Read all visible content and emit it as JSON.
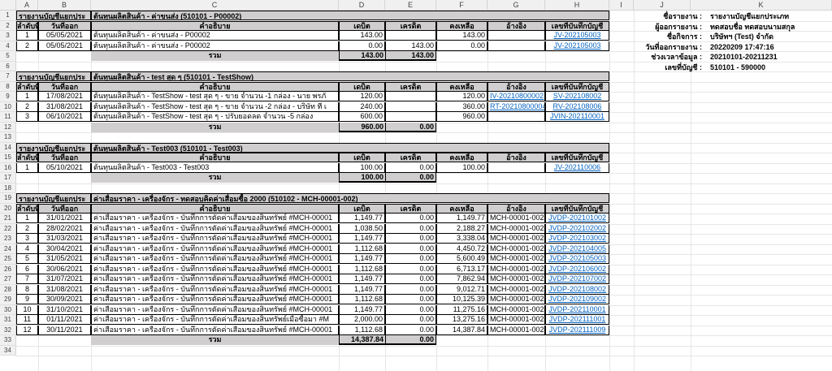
{
  "column_headers": [
    "A",
    "B",
    "C",
    "D",
    "E",
    "F",
    "G",
    "H",
    "I",
    "J",
    "K"
  ],
  "row_numbers": [
    "1",
    "2",
    "3",
    "4",
    "5",
    "6",
    "7",
    "8",
    "9",
    "10",
    "11",
    "12",
    "13",
    "14",
    "15",
    "16",
    "17",
    "18",
    "19",
    "20",
    "21",
    "22",
    "23",
    "24",
    "25",
    "26",
    "27",
    "28",
    "29",
    "30",
    "31",
    "32",
    "33",
    "34"
  ],
  "table_headers": {
    "seq": "ลำดับที่",
    "date": "วันที่ออก",
    "desc": "คำอธิบาย",
    "debit": "เดบิต",
    "credit": "เครดิต",
    "balance": "คงเหลือ",
    "ref": "อ้างอิง",
    "doc": "เลขที่บันทึกบัญชี"
  },
  "total_label": "รวม",
  "info": {
    "labels": [
      "ชื่อรายงาน :",
      "ผู้ออกรายงาน :",
      "ชื่อกิจการ :",
      "วันที่ออกรายงาน :",
      "ช่วงเวลาข้อมูล :",
      "เลขที่บัญชี :"
    ],
    "values": [
      "รายงานบัญชีแยกประเภท",
      "ทดสอบชื่อ ทดสอบนามสกุล",
      "บริษัทฯ (Test) จำกัด",
      "20220209 17:47:16",
      "20210101-20211231",
      "510101 - 590000"
    ]
  },
  "sections": [
    {
      "prefix": "รายงานบัญชีแยกประ",
      "title": "ต้นทุนผลิตสินค้า - ค่าขนส่ง (510101 - P00002)",
      "rows": [
        {
          "seq": "1",
          "date": "05/05/2021",
          "desc": "ต้นทุนผลิตสินค้า - ค่าขนส่ง - P00002",
          "debit": "143.00",
          "credit": "",
          "balance": "143.00",
          "ref": "",
          "doc": "JV-202105003"
        },
        {
          "seq": "2",
          "date": "05/05/2021",
          "desc": "ต้นทุนผลิตสินค้า - ค่าขนส่ง - P00002",
          "debit": "0.00",
          "credit": "143.00",
          "balance": "0.00",
          "ref": "",
          "doc": "JV-202105003"
        }
      ],
      "total_debit": "143.00",
      "total_credit": "143.00"
    },
    {
      "prefix": "รายงานบัญชีแยกประ",
      "title": "ต้นทุนผลิตสินค้า - test สุด ๆ (510101 - TestShow)",
      "rows": [
        {
          "seq": "1",
          "date": "17/08/2021",
          "desc": "ต้นทุนผลิตสินค้า - TestShow - test สุด ๆ - ขาย จำนวน -1 กล่อง - นาย พรภั",
          "debit": "120.00",
          "credit": "",
          "balance": "120.00",
          "ref": "IV-20210800002",
          "doc": "SV-202108002"
        },
        {
          "seq": "2",
          "date": "31/08/2021",
          "desc": "ต้นทุนผลิตสินค้า - TestShow - test สุด ๆ - ขาย จำนวน -2 กล่อง - บริษัท ที่ เ",
          "debit": "240.00",
          "credit": "",
          "balance": "360.00",
          "ref": "RT-20210800004",
          "doc": "RV-202108006"
        },
        {
          "seq": "3",
          "date": "06/10/2021",
          "desc": "ต้นทุนผลิตสินค้า - TestShow - test สุด ๆ - ปรับยอดลด จำนวน -5 กล่อง",
          "debit": "600.00",
          "credit": "",
          "balance": "960.00",
          "ref": "",
          "doc": "JVIN-202110001"
        }
      ],
      "total_debit": "960.00",
      "total_credit": "0.00"
    },
    {
      "prefix": "รายงานบัญชีแยกประ",
      "title": "ต้นทุนผลิตสินค้า - Test003 (510101 - Test003)",
      "rows": [
        {
          "seq": "1",
          "date": "05/10/2021",
          "desc": "ต้นทุนผลิตสินค้า - Test003 - Test003",
          "debit": "100.00",
          "credit": "0.00",
          "balance": "100.00",
          "ref": "",
          "doc": "JV-202110006"
        }
      ],
      "total_debit": "100.00",
      "total_credit": "0.00"
    },
    {
      "prefix": "รายงานบัญชีแยกประ",
      "title": "ค่าเสื่อมราคา - เครื่องจักร - ทดสอบคิดค่าเสื่อมซื้อ 2000 (510102 - MCH-00001-002)",
      "rows": [
        {
          "seq": "1",
          "date": "31/01/2021",
          "desc": "ค่าเสื่อมราคา - เครื่องจักร - บันทึกการตัดค่าเสื่อมของสินทรัพย์ #MCH-00001",
          "debit": "1,149.77",
          "credit": "0.00",
          "balance": "1,149.77",
          "ref": "MCH-00001-002",
          "doc": "JVDP-202101002"
        },
        {
          "seq": "2",
          "date": "28/02/2021",
          "desc": "ค่าเสื่อมราคา - เครื่องจักร - บันทึกการตัดค่าเสื่อมของสินทรัพย์ #MCH-00001",
          "debit": "1,038.50",
          "credit": "0.00",
          "balance": "2,188.27",
          "ref": "MCH-00001-002",
          "doc": "JVDP-202102002"
        },
        {
          "seq": "3",
          "date": "31/03/2021",
          "desc": "ค่าเสื่อมราคา - เครื่องจักร - บันทึกการตัดค่าเสื่อมของสินทรัพย์ #MCH-00001",
          "debit": "1,149.77",
          "credit": "0.00",
          "balance": "3,338.04",
          "ref": "MCH-00001-002",
          "doc": "JVDP-202103002"
        },
        {
          "seq": "4",
          "date": "30/04/2021",
          "desc": "ค่าเสื่อมราคา - เครื่องจักร - บันทึกการตัดค่าเสื่อมของสินทรัพย์ #MCH-00001",
          "debit": "1,112.68",
          "credit": "0.00",
          "balance": "4,450.72",
          "ref": "MCH-00001-002",
          "doc": "JVDP-202104005"
        },
        {
          "seq": "5",
          "date": "31/05/2021",
          "desc": "ค่าเสื่อมราคา - เครื่องจักร - บันทึกการตัดค่าเสื่อมของสินทรัพย์ #MCH-00001",
          "debit": "1,149.77",
          "credit": "0.00",
          "balance": "5,600.49",
          "ref": "MCH-00001-002",
          "doc": "JVDP-202105003"
        },
        {
          "seq": "6",
          "date": "30/06/2021",
          "desc": "ค่าเสื่อมราคา - เครื่องจักร - บันทึกการตัดค่าเสื่อมของสินทรัพย์ #MCH-00001",
          "debit": "1,112.68",
          "credit": "0.00",
          "balance": "6,713.17",
          "ref": "MCH-00001-002",
          "doc": "JVDP-202106002"
        },
        {
          "seq": "7",
          "date": "31/07/2021",
          "desc": "ค่าเสื่อมราคา - เครื่องจักร - บันทึกการตัดค่าเสื่อมของสินทรัพย์ #MCH-00001",
          "debit": "1,149.77",
          "credit": "0.00",
          "balance": "7,862.94",
          "ref": "MCH-00001-002",
          "doc": "JVDP-202107002"
        },
        {
          "seq": "8",
          "date": "31/08/2021",
          "desc": "ค่าเสื่อมราคา - เครื่องจักร - บันทึกการตัดค่าเสื่อมของสินทรัพย์ #MCH-00001",
          "debit": "1,149.77",
          "credit": "0.00",
          "balance": "9,012.71",
          "ref": "MCH-00001-002",
          "doc": "JVDP-202108002"
        },
        {
          "seq": "9",
          "date": "30/09/2021",
          "desc": "ค่าเสื่อมราคา - เครื่องจักร - บันทึกการตัดค่าเสื่อมของสินทรัพย์ #MCH-00001",
          "debit": "1,112.68",
          "credit": "0.00",
          "balance": "10,125.39",
          "ref": "MCH-00001-002",
          "doc": "JVDP-202109002"
        },
        {
          "seq": "10",
          "date": "31/10/2021",
          "desc": "ค่าเสื่อมราคา - เครื่องจักร - บันทึกการตัดค่าเสื่อมของสินทรัพย์ #MCH-00001",
          "debit": "1,149.77",
          "credit": "0.00",
          "balance": "11,275.16",
          "ref": "MCH-00001-002",
          "doc": "JVDP-202110001"
        },
        {
          "seq": "11",
          "date": "01/11/2021",
          "desc": "ค่าเสื่อมราคา - เครื่องจักร - บันทึกการตัดค่าเสื่อมของสินทรัพย์เมื่อซื้อมา #M",
          "debit": "2,000.00",
          "credit": "0.00",
          "balance": "13,275.16",
          "ref": "MCH-00001-002",
          "doc": "JVDP-202111001"
        },
        {
          "seq": "12",
          "date": "30/11/2021",
          "desc": "ค่าเสื่อมราคา - เครื่องจักร - บันทึกการตัดค่าเสื่อมของสินทรัพย์ #MCH-00001",
          "debit": "1,112.68",
          "credit": "0.00",
          "balance": "14,387.84",
          "ref": "MCH-00001-002",
          "doc": "JVDP-202111009"
        }
      ],
      "total_debit": "14,387.84",
      "total_credit": "0.00"
    }
  ]
}
